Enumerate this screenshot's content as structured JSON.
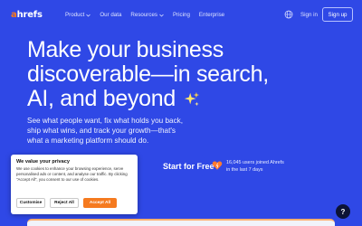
{
  "nav": {
    "logo_a": "a",
    "logo_rest": "hrefs",
    "links": [
      "Product",
      "Our data",
      "Resources",
      "Pricing",
      "Enterprise"
    ],
    "signin": "Sign in",
    "signup": "Sign up",
    "icons": {
      "language": "globe-icon",
      "dropdown": "chevron-down-icon"
    }
  },
  "hero": {
    "headline_line1": "Make your business",
    "headline_line2": "discoverable—in search,",
    "headline_line3": "AI, and beyond",
    "subtext_line1": "See what people want, fix what holds you back,",
    "subtext_line2": "ship what wins, and track your growth—that's",
    "subtext_line3": "what a marketing platform should do."
  },
  "cta": {
    "start_label": "Start for Free",
    "joined_line1": "16,045 users joined Ahrefs",
    "joined_line2": "in the last 7 days"
  },
  "help": {
    "label": "?"
  },
  "cookie": {
    "title": "We value your privacy",
    "text": "We use cookies to enhance your browsing experience, serve personalised ads or content, and analyse our traffic. By clicking \"Accept All\", you consent to our use of cookies.",
    "customise": "Customise",
    "reject": "Reject All",
    "accept": "Accept All"
  },
  "colors": {
    "background": "#2f48e6",
    "accent_orange": "#f57a1f",
    "logo_orange": "#ff7a1a",
    "dark": "#0c1336"
  }
}
